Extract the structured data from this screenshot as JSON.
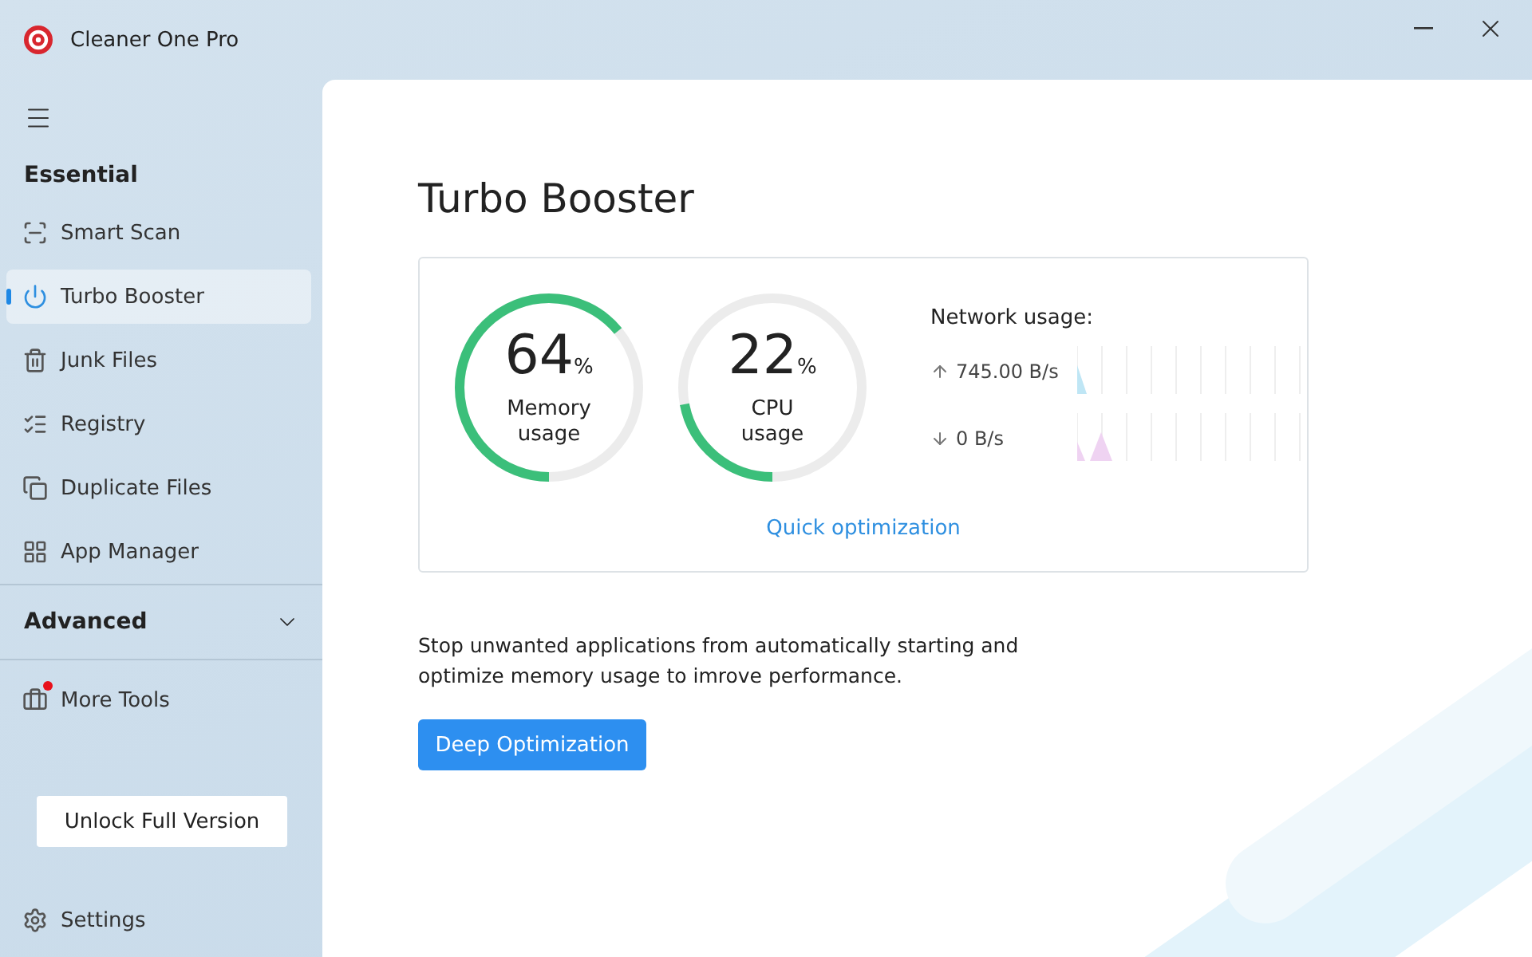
{
  "window": {
    "title": "Cleaner One Pro"
  },
  "sidebar": {
    "sections": [
      {
        "title": "Essential",
        "kind": "group",
        "items": [
          {
            "label": "Smart Scan",
            "kind": "scan",
            "selected": false
          },
          {
            "label": "Turbo Booster",
            "kind": "power",
            "selected": true
          },
          {
            "label": "Junk Files",
            "kind": "trash",
            "selected": false
          },
          {
            "label": "Registry",
            "kind": "list",
            "selected": false
          },
          {
            "label": "Duplicate Files",
            "kind": "copy",
            "selected": false
          },
          {
            "label": "App Manager",
            "kind": "grid",
            "selected": false
          }
        ]
      },
      {
        "title": "Advanced",
        "kind": "collapsible",
        "expanded": false
      }
    ],
    "more_tools": {
      "label": "More Tools",
      "badge": true
    },
    "unlock_button": "Unlock Full Version",
    "settings": "Settings"
  },
  "main": {
    "title": "Turbo Booster",
    "gauges": [
      {
        "value": "64",
        "unit": "%",
        "label": "Memory usage",
        "level": 0.64
      },
      {
        "value": "22",
        "unit": "%",
        "label": "CPU usage",
        "level": 0.22
      }
    ],
    "network": {
      "title": "Network usage:",
      "rows": [
        {
          "kind": "up",
          "reading": "745.00 B/s",
          "color": "#bfe6f5"
        },
        {
          "kind": "down",
          "reading": "0 B/s",
          "color": "#efd3f2"
        }
      ]
    },
    "quick_link": "Quick optimization",
    "description": "Stop unwanted applications from automatically starting and optimize memory usage to imrove performance.",
    "deep_button": "Deep Optimization"
  }
}
